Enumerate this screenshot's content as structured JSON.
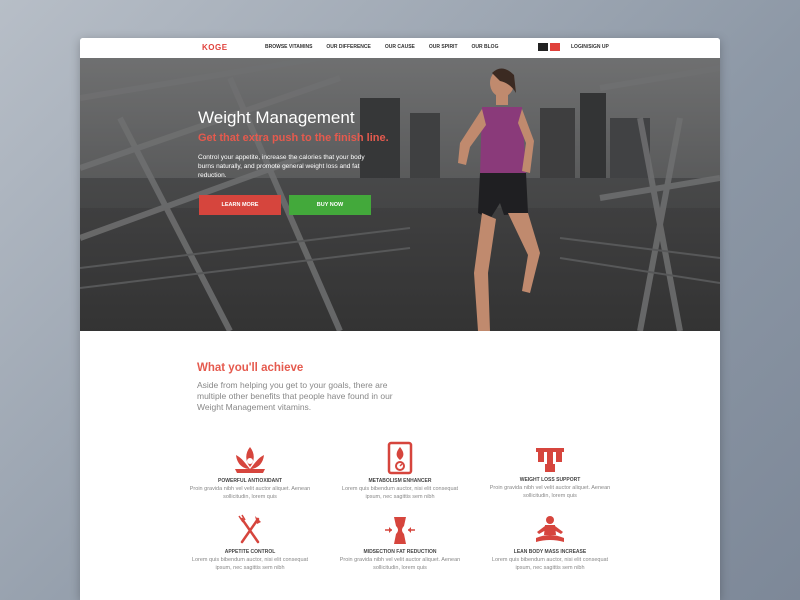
{
  "nav": {
    "logo": "KOGE",
    "links": [
      "BROWSE VITAMINS",
      "OUR DIFFERENCE",
      "OUR CAUSE",
      "OUR SPIRIT",
      "OUR BLOG"
    ],
    "login": "LOGIN/SIGN UP"
  },
  "hero": {
    "title": "Weight Management",
    "subtitle": "Get that extra push to the finish line.",
    "text": "Control your appetite, increase the calories that your body burns naturally, and promote general weight loss and fat reduction.",
    "learn_more": "LEARN MORE",
    "buy_now": "BUY NOW"
  },
  "achieve": {
    "title": "What you'll achieve",
    "text": "Aside from helping you get to your goals, there are multiple other benefits that people have found in our Weight Management vitamins."
  },
  "features": [
    {
      "title": "POWERFUL ANTIOXIDANT",
      "desc": "Proin gravida nibh vel velit auctor aliquet. Aenean sollicitudin, lorem quis",
      "icon": "lotus-icon"
    },
    {
      "title": "METABOLISM ENHANCER",
      "desc": "Lorem quis bibendum auctor, nisi elit consequat ipsum, nec sagittis sem nibh",
      "icon": "flame-scale-icon"
    },
    {
      "title": "WEIGHT LOSS SUPPORT",
      "desc": "Proin gravida nibh vel velit auctor aliquet. Aenean sollicitudin, lorem quis",
      "icon": "dumbbell-icon"
    },
    {
      "title": "APPETITE CONTROL",
      "desc": "Lorem quis bibendum auctor, nisi elit consequat ipsum, nec sagittis sem nibh",
      "icon": "fork-knife-icon"
    },
    {
      "title": "MIDSECTION FAT REDUCTION",
      "desc": "Proin gravida nibh vel velit auctor aliquet. Aenean sollicitudin, lorem quis",
      "icon": "torso-icon"
    },
    {
      "title": "LEAN BODY MASS INCREASE",
      "desc": "Lorem quis bibendum auctor, nisi elit consequat ipsum, nec sagittis sem nibh",
      "icon": "meditation-icon"
    }
  ],
  "colors": {
    "accent": "#e0413b",
    "buy": "#43a93b",
    "icon": "#d6453d"
  }
}
